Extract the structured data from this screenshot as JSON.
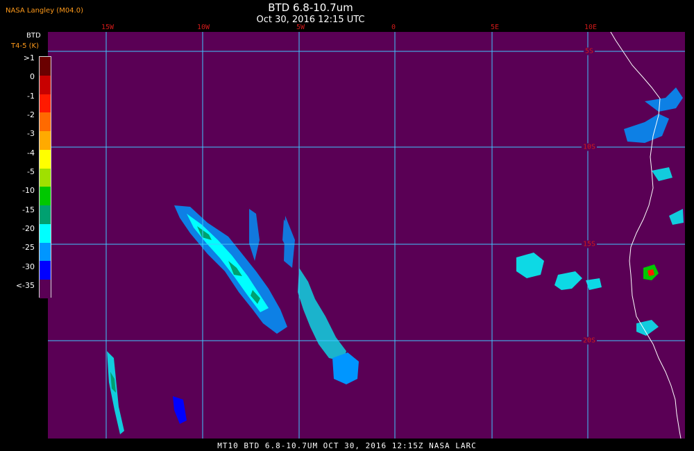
{
  "header": {
    "agency": "NASA Langley (M04.0)",
    "title": "BTD 6.8-10.7um",
    "subtitle": "Oct 30, 2016 12:15 UTC"
  },
  "legend": {
    "label_line1": "BTD",
    "label_line2": "T4-5 (K)",
    "entries": [
      {
        "label": ">1",
        "color": "#6a0000"
      },
      {
        "label": "0",
        "color": "#c80000"
      },
      {
        "label": "-1",
        "color": "#ff1a00"
      },
      {
        "label": "-2",
        "color": "#ff6a00"
      },
      {
        "label": "-3",
        "color": "#ffaa00"
      },
      {
        "label": "-4",
        "color": "#ffff00"
      },
      {
        "label": "-5",
        "color": "#a0e000"
      },
      {
        "label": "-10",
        "color": "#00c800"
      },
      {
        "label": "-15",
        "color": "#00a070"
      },
      {
        "label": "-20",
        "color": "#00ffff"
      },
      {
        "label": "-25",
        "color": "#0096ff"
      },
      {
        "label": "-30",
        "color": "#0000ff"
      },
      {
        "label": "<-35",
        "color": "#5a0055"
      }
    ]
  },
  "map": {
    "background_color": "#5a0055",
    "grid_color": "#40c8ff",
    "coast_color": "#ffffff",
    "lon_labels": [
      "15W",
      "10W",
      "5W",
      "0",
      "5E",
      "10E"
    ],
    "lat_labels": [
      "5S",
      "10S",
      "15S",
      "20S"
    ]
  },
  "footer": {
    "text": "MT10   BTD 6.8-10.7UM    OCT 30, 2016 12:15Z    NASA LARC"
  }
}
